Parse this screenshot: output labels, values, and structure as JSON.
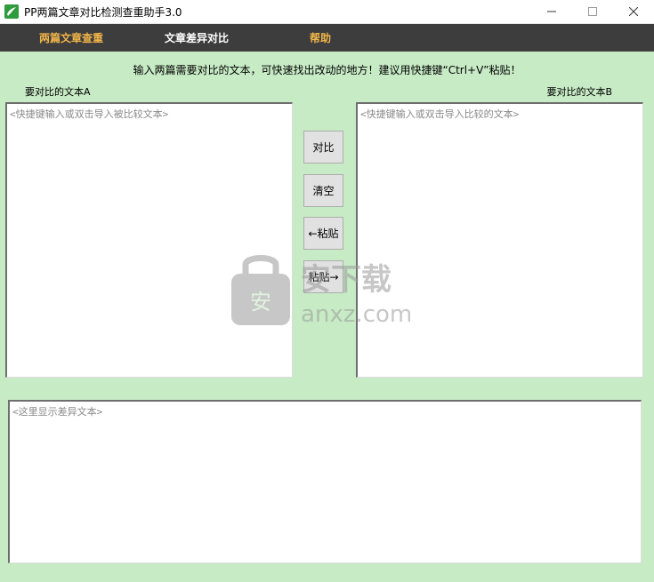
{
  "window": {
    "title": "PP两篇文章对比检测查重助手3.0",
    "controls": {
      "minimize": "—",
      "maximize": "☐",
      "close": "✕"
    }
  },
  "menu": [
    {
      "label": "两篇文章查重",
      "color": "#f1b54a"
    },
    {
      "label": "文章差异对比",
      "color": "#ffffff"
    },
    {
      "label": "帮助",
      "color": "#f1b54a"
    }
  ],
  "instruction": "输入两篇需要对比的文本，可快速找出改动的地方！建议用快捷键“Ctrl+V”粘贴！",
  "left_panel": {
    "label": "要对比的文本A",
    "placeholder": "<快捷键输入或双击导入被比较文本>"
  },
  "right_panel": {
    "label": "要对比的文本B",
    "placeholder": "<快捷键输入或双击导入比较的文本>"
  },
  "buttons": {
    "compare": "对比",
    "clear": "清空",
    "paste_left": "←粘贴",
    "paste_right": "粘贴→"
  },
  "diff_output": {
    "placeholder": "<这里显示差异文本>"
  },
  "watermark": {
    "text": "安下载",
    "domain": "anxz.com"
  },
  "colors": {
    "background": "#c7ebc5",
    "menubar": "#3d3d3d",
    "menu_active": "#f1b54a"
  }
}
